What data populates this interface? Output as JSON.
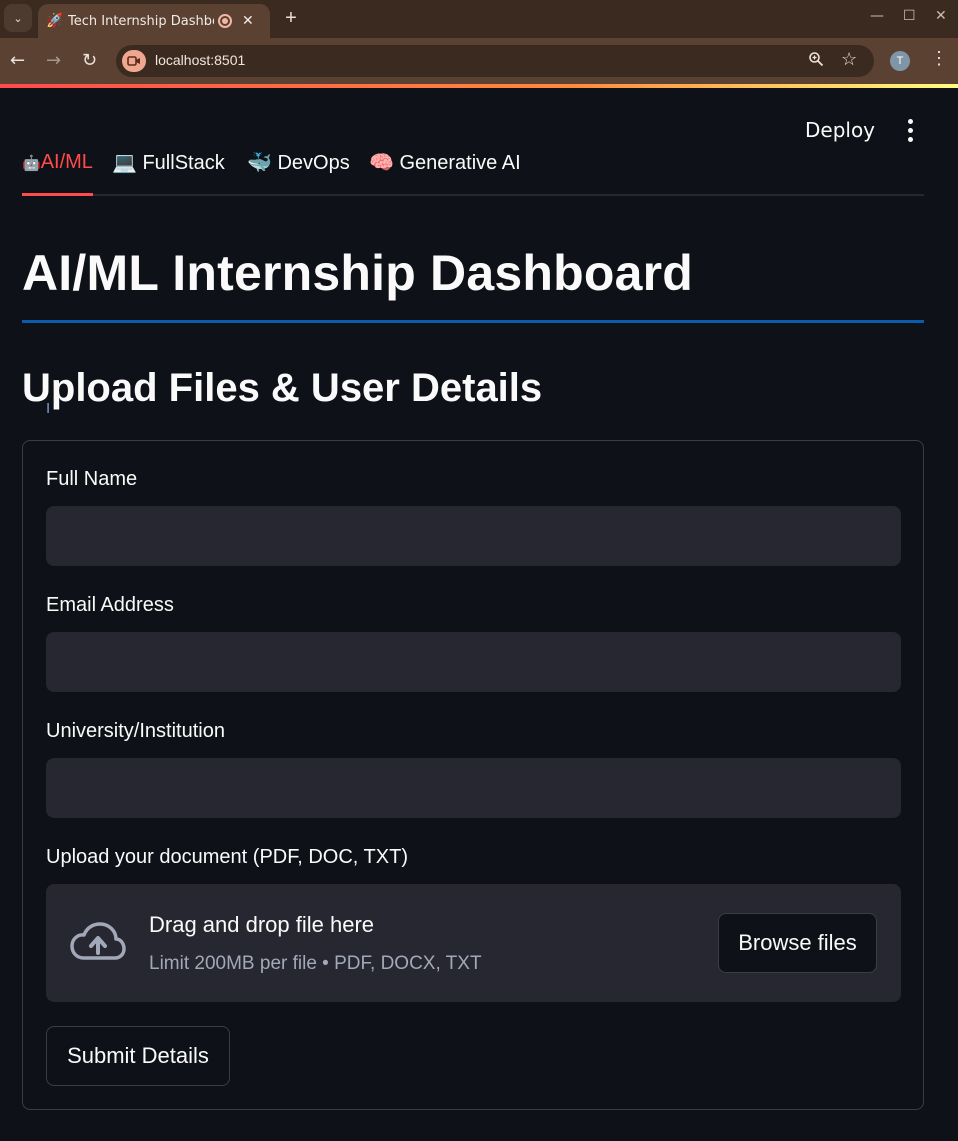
{
  "browser": {
    "tab_title": "Tech Internship Dashbo",
    "tab_favicon": "🚀",
    "url": "localhost:8501",
    "profile_initial": "T",
    "icons": {
      "tab_list": "chevron-down-icon",
      "recording": "recording-indicator-icon",
      "close": "close-icon",
      "new_tab": "plus-icon",
      "back": "back-arrow-icon",
      "forward": "forward-arrow-icon",
      "reload": "reload-icon",
      "site": "video-camera-icon",
      "zoom": "zoom-icon",
      "bookmark": "star-icon",
      "menu": "kebab-menu-icon"
    }
  },
  "header": {
    "deploy_label": "Deploy"
  },
  "tabs": [
    {
      "emoji": "🤖",
      "label": "AI/ML",
      "active": true
    },
    {
      "emoji": "💻",
      "label": "FullStack",
      "active": false
    },
    {
      "emoji": "🐳",
      "label": "DevOps",
      "active": false
    },
    {
      "emoji": "🧠",
      "label": "Generative AI",
      "active": false
    }
  ],
  "main": {
    "title": "AI/ML Internship Dashboard",
    "section_title": "Upload Files & User Details"
  },
  "form": {
    "full_name": {
      "label": "Full Name",
      "value": "",
      "placeholder": ""
    },
    "email": {
      "label": "Email Address",
      "value": "",
      "placeholder": ""
    },
    "university": {
      "label": "University/Institution",
      "value": "",
      "placeholder": ""
    },
    "upload": {
      "label": "Upload your document (PDF, DOC, TXT)",
      "drop_title": "Drag and drop file here",
      "drop_limit": "Limit 200MB per file • PDF, DOCX, TXT",
      "browse_label": "Browse files"
    },
    "submit_label": "Submit Details"
  },
  "colors": {
    "background": "#0e1117",
    "accent": "#ff4b4b",
    "input_bg": "#262730",
    "title_rule": "#0b5cad"
  }
}
